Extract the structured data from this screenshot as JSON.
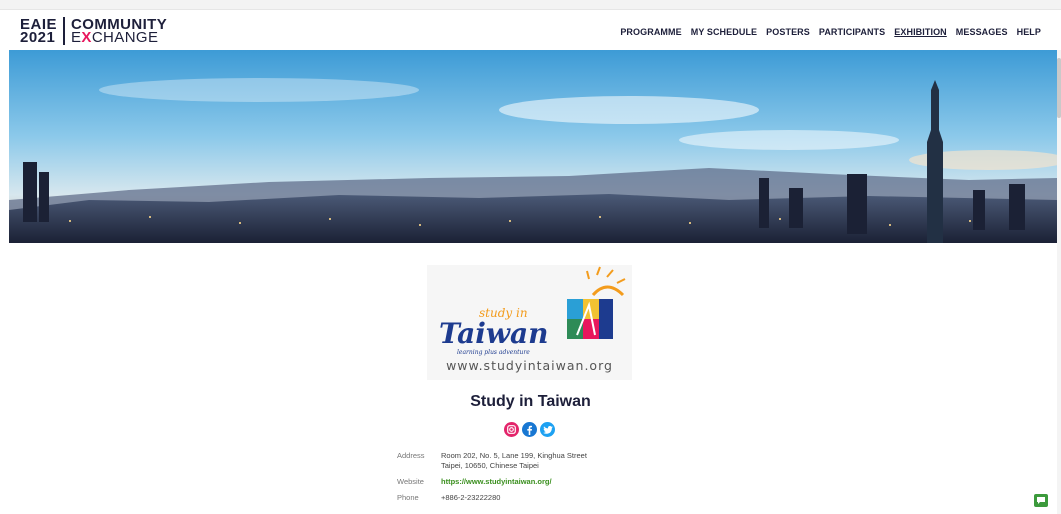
{
  "header": {
    "logo": {
      "year_top": "EAIE",
      "year_bottom": "2021",
      "line1": "COMMUNITY",
      "line2_pre": "E",
      "line2_x": "X",
      "line2_post": "CHANGE"
    },
    "nav": [
      {
        "label": "PROGRAMME",
        "active": false
      },
      {
        "label": "MY SCHEDULE",
        "active": false
      },
      {
        "label": "POSTERS",
        "active": false
      },
      {
        "label": "PARTICIPANTS",
        "active": false
      },
      {
        "label": "EXHIBITION",
        "active": true
      },
      {
        "label": "MESSAGES",
        "active": false
      },
      {
        "label": "HELP",
        "active": false
      }
    ]
  },
  "exhibitor": {
    "logo_text": {
      "study_in": "study in",
      "taiwan": "Taiwan",
      "tagline": "learning plus adventure",
      "url": "www.studyintaiwan.org"
    },
    "name": "Study in Taiwan",
    "social": [
      {
        "icon": "instagram-icon"
      },
      {
        "icon": "facebook-icon"
      },
      {
        "icon": "twitter-icon"
      }
    ],
    "address_label": "Address",
    "address_line1": "Room 202, No. 5, Lane 199, Kinghua Street",
    "address_line2": "Taipei, 10650, Chinese Taipei",
    "website_label": "Website",
    "website": "https://www.studyintaiwan.org/",
    "phone_label": "Phone",
    "phone": "+886-2-23222280"
  },
  "colors": {
    "navy": "#1d1f3a",
    "accent_pink": "#e8175d",
    "link_green": "#3a8f1e",
    "chat_green": "#3c9a3c"
  }
}
